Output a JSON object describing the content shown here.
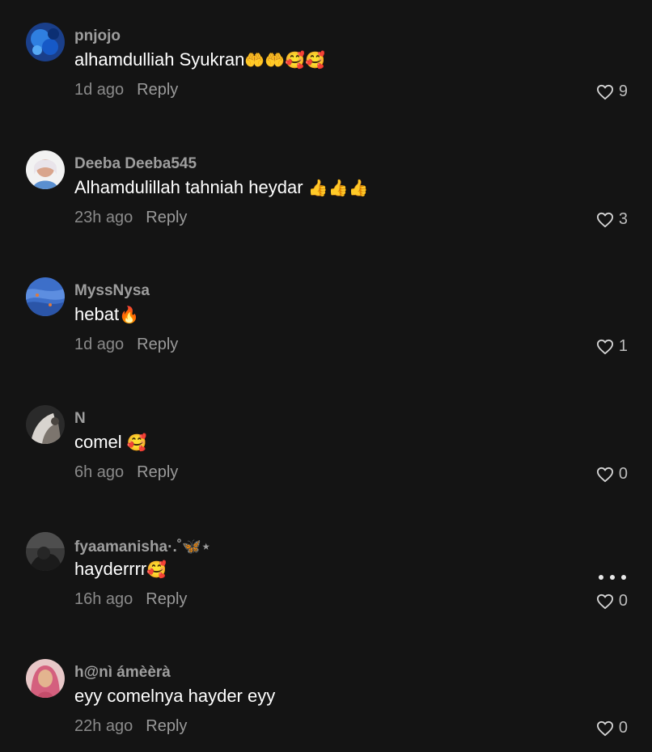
{
  "comments": [
    {
      "username": "pnjojo",
      "text": "alhamdulliah Syukran",
      "emojis": "🤲🤲🥰🥰",
      "time": "1d ago",
      "reply": "Reply",
      "likes": "9"
    },
    {
      "username": "Deeba Deeba545",
      "text": "Alhamdulillah tahniah heydar ",
      "emojis": "👍👍👍",
      "time": "23h ago",
      "reply": "Reply",
      "likes": "3"
    },
    {
      "username": "MyssNysa",
      "text": "hebat",
      "emojis": "🔥",
      "time": "1d ago",
      "reply": "Reply",
      "likes": "1"
    },
    {
      "username": "N",
      "text": "comel ",
      "emojis": "🥰",
      "time": "6h ago",
      "reply": "Reply",
      "likes": "0"
    },
    {
      "username": "fyaamanisha·.˚🦋⋆",
      "text": "hayderrrr",
      "emojis": "🥰",
      "time": "16h ago",
      "reply": "Reply",
      "likes": "0"
    },
    {
      "username": "h@nì ámèèrà",
      "text": "eyy comelnya hayder eyy",
      "emojis": "",
      "time": "22h ago",
      "reply": "Reply",
      "likes": "0"
    }
  ],
  "icons": {
    "like": "heart-outline-icon",
    "more": "more-horizontal-icon"
  },
  "colors": {
    "background": "#141414",
    "username": "#9e9e9e",
    "text": "#ffffff",
    "meta": "#8a8a8a"
  }
}
